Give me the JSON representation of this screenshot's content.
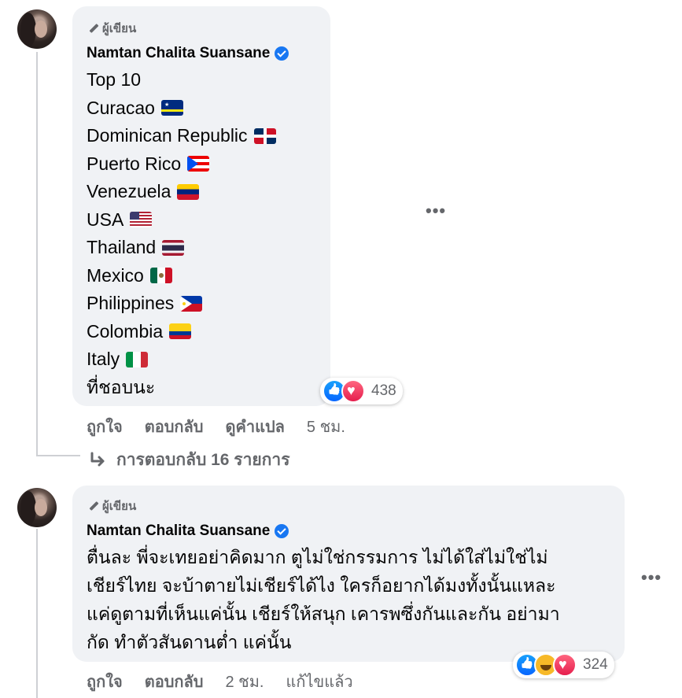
{
  "comment1": {
    "badge": "ผู้เขียน",
    "author": "Namtan Chalita Suansane",
    "lines": [
      {
        "text": "Top 10",
        "flag": ""
      },
      {
        "text": "Curacao",
        "flag": "curacao"
      },
      {
        "text": "Dominican Republic",
        "flag": "dominican-republic"
      },
      {
        "text": "Puerto Rico",
        "flag": "puerto-rico"
      },
      {
        "text": "Venezuela",
        "flag": "venezuela"
      },
      {
        "text": "USA",
        "flag": "usa"
      },
      {
        "text": "Thailand",
        "flag": "thailand"
      },
      {
        "text": "Mexico",
        "flag": "mexico"
      },
      {
        "text": "Philippines",
        "flag": "philippines"
      },
      {
        "text": "Colombia",
        "flag": "colombia"
      },
      {
        "text": "Italy",
        "flag": "italy"
      },
      {
        "text": "ที่ชอบนะ",
        "flag": ""
      }
    ],
    "reaction_count": "438",
    "actions": {
      "like": "ถูกใจ",
      "reply": "ตอบกลับ",
      "translate": "ดูคำแปล",
      "time": "5 ชม."
    },
    "replies_link": "การตอบกลับ 16 รายการ",
    "more": "•••"
  },
  "comment2": {
    "badge": "ผู้เขียน",
    "author": "Namtan Chalita Suansane",
    "body_lines": [
      "ตื่นละ พี่จะเทยอย่าคิดมาก ตูไม่ใช่กรรมการ ไม่ได้ใส่ไม่ใช่ไม่",
      "เชียร์ไทย จะบ้าตายไม่เชียร์ได้ไง ใครก็อยากได้มงทั้งนั้นแหละ",
      "แค่ดูตามที่เห็นแค่นั้น เชียร์ให้สนุก เคารพซึ่งกันและกัน อย่ามา",
      "กัด ทำตัวสันดานต่ำ แค่นั้น"
    ],
    "reaction_count": "324",
    "actions": {
      "like": "ถูกใจ",
      "reply": "ตอบกลับ",
      "time": "2 ชม.",
      "edited": "แก้ไขแล้ว"
    },
    "more": "•••"
  },
  "colors": {
    "bubble": "#f0f2f5",
    "secondary_text": "#65676b",
    "verified": "#1877f2",
    "like": "#0866ff",
    "love": "#e61e4d"
  }
}
